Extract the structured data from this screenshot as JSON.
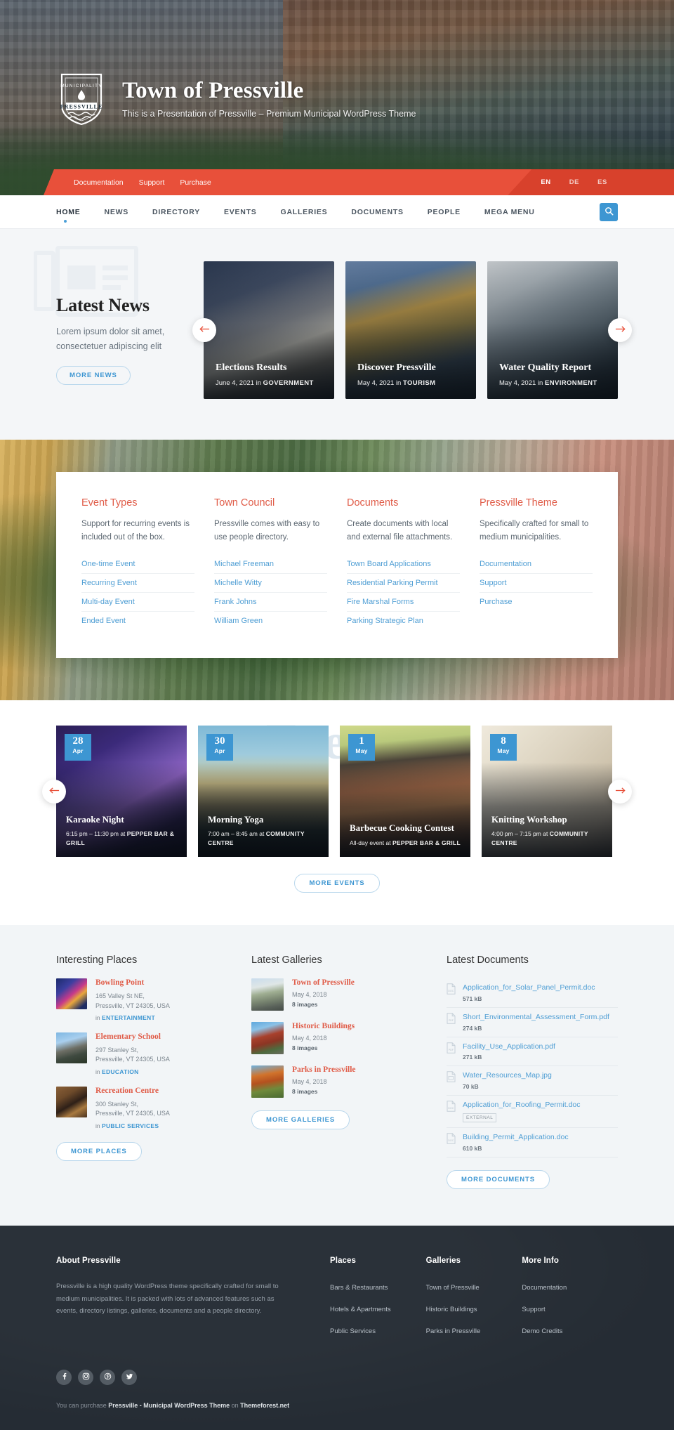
{
  "site": {
    "title": "Town of Pressville",
    "tagline": "This is a Presentation of Pressville – Premium Municipal WordPress Theme",
    "crest_top": "MUNICIPALITY",
    "crest_name": "PRESSVILLE"
  },
  "topbar": {
    "links": [
      {
        "label": "Documentation"
      },
      {
        "label": "Support"
      },
      {
        "label": "Purchase"
      }
    ],
    "languages": [
      {
        "code": "EN",
        "active": true
      },
      {
        "code": "DE",
        "active": false
      },
      {
        "code": "ES",
        "active": false
      }
    ]
  },
  "mainnav": {
    "items": [
      {
        "label": "HOME",
        "active": true
      },
      {
        "label": "NEWS",
        "active": false
      },
      {
        "label": "DIRECTORY",
        "active": false
      },
      {
        "label": "EVENTS",
        "active": false
      },
      {
        "label": "GALLERIES",
        "active": false
      },
      {
        "label": "DOCUMENTS",
        "active": false
      },
      {
        "label": "PEOPLE",
        "active": false
      },
      {
        "label": "MEGA MENU",
        "active": false
      }
    ],
    "search_icon": "search-icon"
  },
  "news": {
    "heading": "Latest News",
    "description": "Lorem ipsum dolor sit amet, consectetuer adipiscing elit",
    "more_label": "MORE NEWS",
    "prev_icon": "arrow-left-icon",
    "next_icon": "arrow-right-icon",
    "cards": [
      {
        "title": "Elections Results",
        "date": "June 4, 2021",
        "in_word": "in",
        "category": "GOVERNMENT"
      },
      {
        "title": "Discover Pressville",
        "date": "May 4, 2021",
        "in_word": "in",
        "category": "TOURISM"
      },
      {
        "title": "Water Quality Report",
        "date": "May 4, 2021",
        "in_word": "in",
        "category": "ENVIRONMENT"
      }
    ]
  },
  "features": [
    {
      "heading": "Event Types",
      "text": "Support for recurring events is included out of the box.",
      "links": [
        "One-time Event",
        "Recurring Event",
        "Multi-day Event",
        "Ended Event"
      ]
    },
    {
      "heading": "Town Council",
      "text": "Pressville comes with easy to use people directory.",
      "links": [
        "Michael Freeman",
        "Michelle Witty",
        "Frank Johns",
        "William Green"
      ]
    },
    {
      "heading": "Documents",
      "text": "Create documents with local and external file attachments.",
      "links": [
        "Town Board Applications",
        "Residential Parking Permit",
        "Fire Marshal Forms",
        "Parking Strategic Plan"
      ]
    },
    {
      "heading": "Pressville Theme",
      "text": "Specifically crafted for small to medium municipalities.",
      "links": [
        "Documentation",
        "Support",
        "Purchase"
      ]
    }
  ],
  "events": {
    "watermark": "Events",
    "more_label": "MORE EVENTS",
    "prev_icon": "arrow-left-icon",
    "next_icon": "arrow-right-icon",
    "cards": [
      {
        "day": "28",
        "month": "Apr",
        "title": "Karaoke Night",
        "time": "6:15 pm – 11:30 pm at ",
        "venue": "PEPPER BAR & GRILL"
      },
      {
        "day": "30",
        "month": "Apr",
        "title": "Morning Yoga",
        "time": "7:00 am – 8:45 am at ",
        "venue": "COMMUNITY CENTRE"
      },
      {
        "day": "1",
        "month": "May",
        "title": "Barbecue Cooking Contest",
        "time": "All-day event at ",
        "venue": "PEPPER BAR & GRILL"
      },
      {
        "day": "8",
        "month": "May",
        "title": "Knitting Workshop",
        "time": "4:00 pm – 7:15 pm at ",
        "venue": "COMMUNITY CENTRE"
      }
    ]
  },
  "places": {
    "heading": "Interesting Places",
    "more_label": "MORE PLACES",
    "items": [
      {
        "name": "Bowling Point",
        "address": "165 Valley St NE,\nPressville, VT 24305, USA",
        "in_word": "in",
        "category": "ENTERTAINMENT"
      },
      {
        "name": "Elementary School",
        "address": "297 Stanley St,\nPressville, VT 24305, USA",
        "in_word": "in",
        "category": "EDUCATION"
      },
      {
        "name": "Recreation Centre",
        "address": "300 Stanley St,\nPressville, VT 24305, USA",
        "in_word": "in",
        "category": "PUBLIC SERVICES"
      }
    ]
  },
  "galleries": {
    "heading": "Latest Galleries",
    "more_label": "MORE GALLERIES",
    "items": [
      {
        "name": "Town of Pressville",
        "date": "May 4, 2018",
        "count": "8 images"
      },
      {
        "name": "Historic Buildings",
        "date": "May 4, 2018",
        "count": "8 images"
      },
      {
        "name": "Parks in Pressville",
        "date": "May 4, 2018",
        "count": "8 images"
      }
    ]
  },
  "documents": {
    "heading": "Latest Documents",
    "more_label": "MORE DOCUMENTS",
    "items": [
      {
        "filename": "Application_for_Solar_Panel_Permit.doc",
        "size": "571 kB",
        "kind": "DOC",
        "badge": ""
      },
      {
        "filename": "Short_Environmental_Assessment_Form.pdf",
        "size": "274 kB",
        "kind": "PDF",
        "badge": ""
      },
      {
        "filename": "Facility_Use_Application.pdf",
        "size": "271 kB",
        "kind": "PDF",
        "badge": ""
      },
      {
        "filename": "Water_Resources_Map.jpg",
        "size": "70 kB",
        "kind": "JPG",
        "badge": ""
      },
      {
        "filename": "Application_for_Roofing_Permit.doc",
        "size": "",
        "kind": "DOC",
        "badge": "EXTERNAL"
      },
      {
        "filename": "Building_Permit_Application.doc",
        "size": "610 kB",
        "kind": "DOC",
        "badge": ""
      }
    ]
  },
  "footer": {
    "about_heading": "About Pressville",
    "about_text": "Pressville is a high quality WordPress theme specifically crafted for small to medium municipalities. It is packed with lots of advanced features such as events, directory listings, galleries, documents and a people directory.",
    "columns": [
      {
        "heading": "Places",
        "links": [
          "Bars & Restaurants",
          "Hotels & Apartments",
          "Public Services"
        ]
      },
      {
        "heading": "Galleries",
        "links": [
          "Town of Pressville",
          "Historic Buildings",
          "Parks in Pressville"
        ]
      },
      {
        "heading": "More Info",
        "links": [
          "Documentation",
          "Support",
          "Demo Credits"
        ]
      }
    ],
    "socials": [
      "facebook-icon",
      "instagram-icon",
      "pinterest-icon",
      "twitter-icon"
    ],
    "copy_pre": "You can purchase ",
    "copy_bold1": "Pressville - Municipal WordPress Theme",
    "copy_mid": " on ",
    "copy_bold2": "Themeforest.net"
  },
  "colors": {
    "accent_red": "#e8503a",
    "accent_blue": "#3d96d2",
    "link_blue": "#4f9ed4",
    "footer_bg": "#252c34",
    "heading_red": "#e05c48"
  }
}
